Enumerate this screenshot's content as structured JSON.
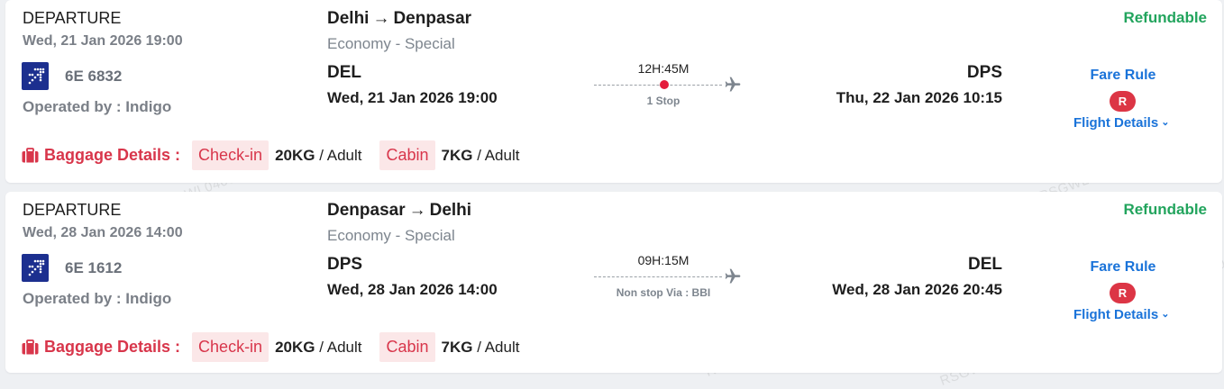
{
  "flights": [
    {
      "direction_label": "DEPARTURE",
      "depart_datetime": "Wed, 21 Jan 2026 19:00",
      "flight_number": "6E 6832",
      "operated_by": "Operated by : Indigo",
      "route_from": "Delhi",
      "route_arrow": "→",
      "route_to": "Denpasar",
      "cabin_class": "Economy - Special",
      "from_code": "DEL",
      "from_datetime": "Wed, 21 Jan 2026 19:00",
      "duration": "12H:45M",
      "stops_text": "1 Stop",
      "has_stop_dot": true,
      "to_code": "DPS",
      "to_datetime": "Thu, 22 Jan 2026 10:15",
      "refund_status": "Refundable",
      "fare_rule_label": "Fare Rule",
      "fare_badge": "R",
      "flight_details_label": "Flight Details",
      "baggage_label": "Baggage Details :",
      "checkin_label": "Check-in",
      "checkin_weight": "20KG",
      "checkin_unit": " / Adult",
      "cabin_label": "Cabin",
      "cabin_weight": "7KG",
      "cabin_unit": " / Adult"
    },
    {
      "direction_label": "DEPARTURE",
      "depart_datetime": "Wed, 28 Jan 2026 14:00",
      "flight_number": "6E 1612",
      "operated_by": "Operated by : Indigo",
      "route_from": "Denpasar",
      "route_arrow": "→",
      "route_to": "Delhi",
      "cabin_class": "Economy - Special",
      "from_code": "DPS",
      "from_datetime": "Wed, 28 Jan 2026 14:00",
      "duration": "09H:15M",
      "stops_text": "Non stop Via : BBI",
      "has_stop_dot": false,
      "to_code": "DEL",
      "to_datetime": "Wed, 28 Jan 2026 20:45",
      "refund_status": "Refundable",
      "fare_rule_label": "Fare Rule",
      "fare_badge": "R",
      "flight_details_label": "Flight Details",
      "baggage_label": "Baggage Details :",
      "checkin_label": "Check-in",
      "checkin_weight": "20KG",
      "checkin_unit": " / Adult",
      "cabin_label": "Cabin",
      "cabin_weight": "7KG",
      "cabin_unit": " / Adult"
    }
  ],
  "watermark_text": "RSGWL0400005",
  "colors": {
    "refundable": "#22a45d",
    "link": "#1a73d9",
    "baggage": "#d8364b",
    "badge": "#dc3545",
    "airline_logo": "#1c2f8f"
  },
  "icons": {
    "airline_logo": "indigo-logo-icon",
    "plane": "airplane-icon",
    "baggage": "briefcase-icon",
    "chevron": "chevron-down-icon",
    "route_arrow": "arrow-right-icon"
  }
}
